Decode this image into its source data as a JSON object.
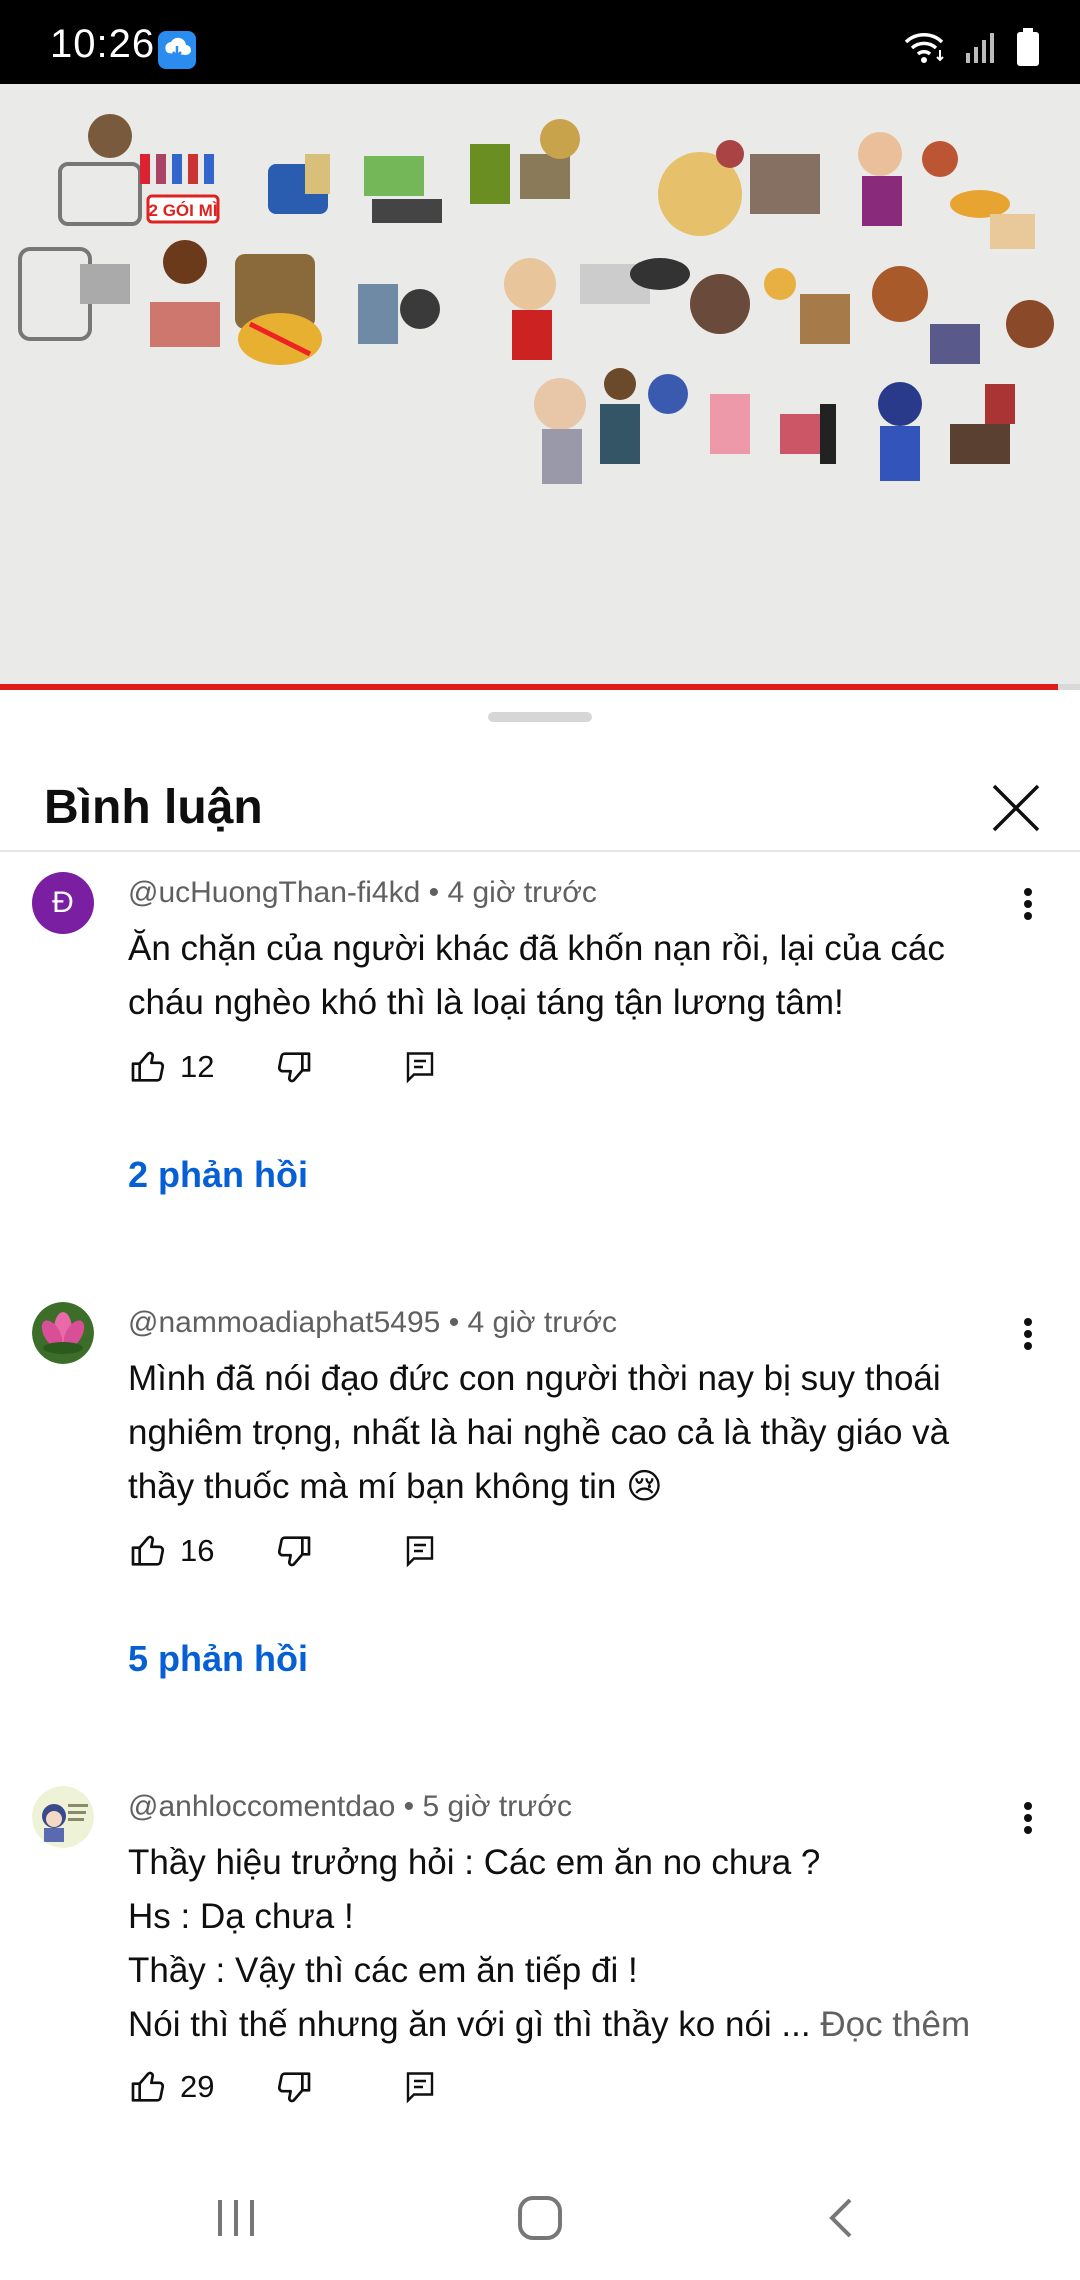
{
  "status_bar": {
    "time": "10:26",
    "icons": [
      "app-notification-icon",
      "wifi-icon",
      "signal-icon",
      "battery-icon"
    ]
  },
  "video": {
    "progress_fraction": 0.98,
    "progress_color": "#e01b1b"
  },
  "comments_sheet": {
    "title": "Bình luận",
    "comments": [
      {
        "author": "@ucHuongThan-fi4kd",
        "time": "4 giờ trước",
        "avatar_letter": "Đ",
        "text_lines": [
          "Ăn chặn của người khác đã khốn nạn rồi, lại của các",
          "cháu nghèo khó thì là loại táng tận lương tâm!"
        ],
        "likes": "12",
        "replies": "2 phản hồi"
      },
      {
        "author": "@nammoadiaphat5495",
        "time": "4 giờ trước",
        "text_lines": [
          "Mình đã nói đạo đức con người thời nay bị suy thoái",
          "nghiêm trọng, nhất là hai nghề cao cả là thầy giáo và",
          "thầy thuốc mà mí bạn không tin 😢"
        ],
        "likes": "16",
        "replies": "5 phản hồi"
      },
      {
        "author": "@anhloccomentdao",
        "time": "5 giờ trước",
        "text_lines": [
          "Thầy hiệu trưởng hỏi : Các em ăn no chưa ?",
          "Hs : Dạ chưa !",
          "Thầy : Vậy thì các em ăn tiếp đi !",
          "Nói thì thế nhưng ăn với gì thì thầy ko nói ..."
        ],
        "read_more": "Đọc thêm",
        "likes": "29"
      }
    ]
  },
  "colors": {
    "link_blue": "#065fd4",
    "meta_gray": "#606060"
  }
}
